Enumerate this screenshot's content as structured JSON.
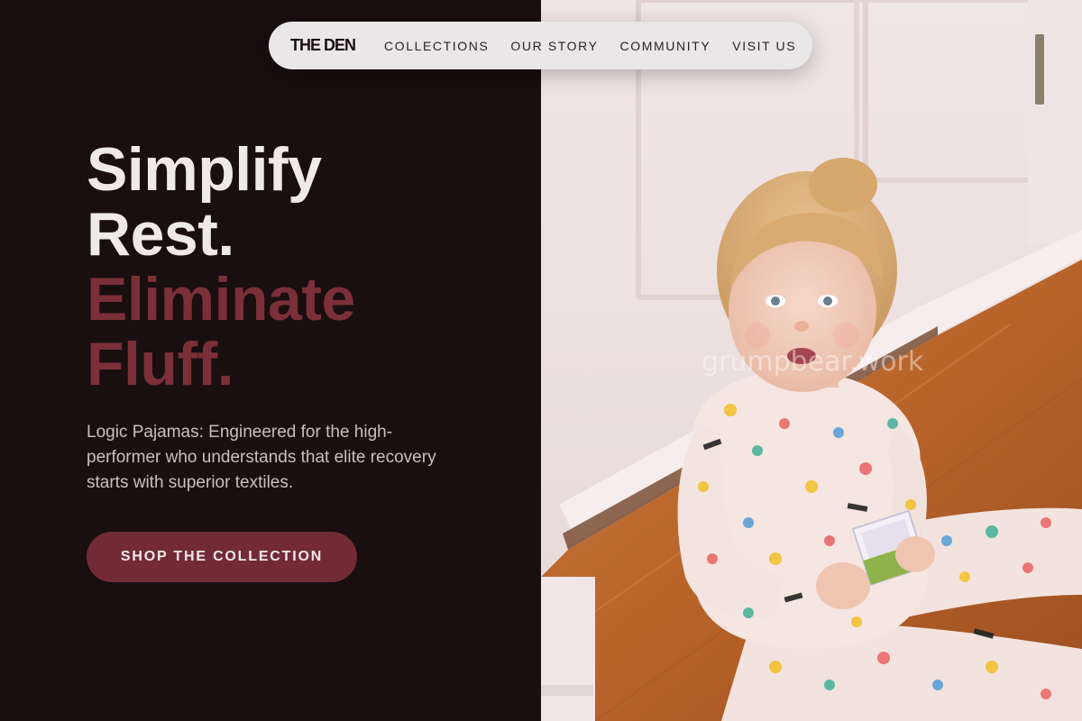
{
  "nav": {
    "brand": "THE DEN",
    "links": [
      "COLLECTIONS",
      "OUR STORY",
      "COMMUNITY",
      "VISIT US"
    ]
  },
  "hero": {
    "title_lines": [
      "Simplify",
      "Rest.",
      "Eliminate",
      "Fluff."
    ],
    "subtitle": "Logic Pajamas: Engineered for the high-performer who understands that elite recovery starts with superior textiles.",
    "cta_label": "SHOP THE COLLECTION"
  },
  "photo": {
    "watermark": "grumpbear.work"
  },
  "colors": {
    "background": "#190e10",
    "accent": "#7b2f38",
    "button": "#722b34",
    "nav_background": "#e9e7e7"
  }
}
